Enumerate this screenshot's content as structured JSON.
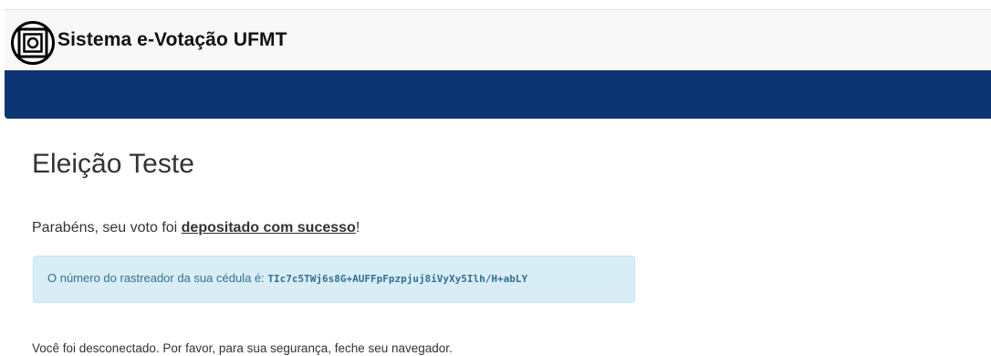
{
  "header": {
    "brand": "Sistema e-Votação UFMT",
    "logo_icon": "ufmt-logo-icon"
  },
  "colors": {
    "navbar": "#0e3573",
    "alert_bg": "#d9edf7",
    "alert_text": "#31708f"
  },
  "main": {
    "title": "Eleição Teste",
    "success": {
      "prefix": "Parabéns, seu voto foi ",
      "emphasis": "depositado com sucesso",
      "suffix": "!"
    },
    "tracker": {
      "label": "O número do rastreador da sua cédula é: ",
      "code": "TIc7c5TWj6s8G+AUFFpFpzpjuj8iVyXy5Ilh/H+abLY"
    },
    "logout_note": "Você foi desconectado. Por favor, para sua segurança, feche seu navegador."
  }
}
